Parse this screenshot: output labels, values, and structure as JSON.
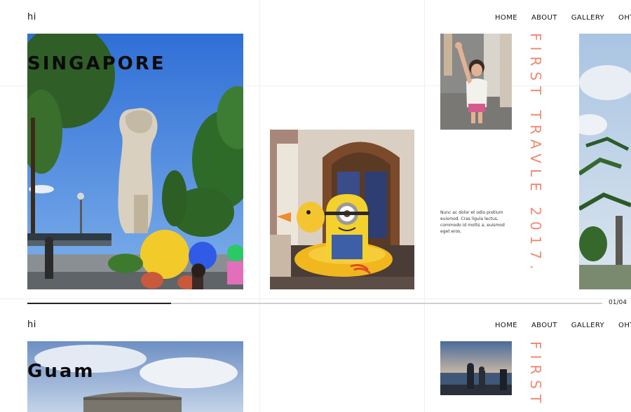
{
  "brand": "hi",
  "nav": [
    "HOME",
    "ABOUT",
    "GALLERY",
    "OHTERS"
  ],
  "slide1": {
    "title": "SINGAPORE",
    "vertical_title": "FIRST TRAVLE 2017.",
    "caption": "Nunc ac dolor et odio pretium euismod. Cras ligula lectus, commodo id mollis a, euismod eget eros.",
    "progress": 0.25,
    "counter": "01/04"
  },
  "slide2": {
    "title": "Guam",
    "vertical_title": "FIRST"
  },
  "colors": {
    "accent": "#f08a75",
    "progress_fill": "#222222",
    "progress_track": "#cfcfcf"
  }
}
